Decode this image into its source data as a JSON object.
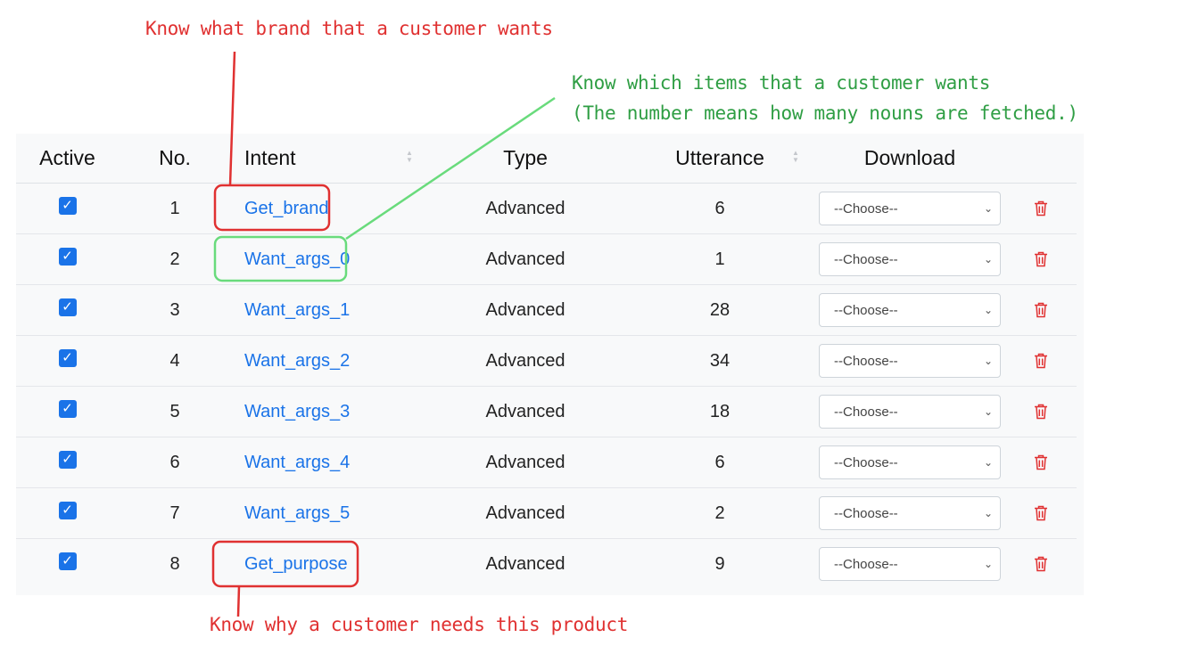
{
  "annotations": {
    "top": "Know what brand that a customer wants",
    "right_line1": "Know which items that a customer wants",
    "right_line2": "(The number means how many nouns are fetched.)",
    "bottom": "Know why a customer needs this product"
  },
  "colors": {
    "red": "#e03131",
    "green": "#2f9e44",
    "link": "#1a73e8",
    "checkbox": "#1a73e8"
  },
  "table": {
    "headers": {
      "active": "Active",
      "no": "No.",
      "intent": "Intent",
      "type": "Type",
      "utterance": "Utterance",
      "download": "Download"
    },
    "rows": [
      {
        "no": "1",
        "intent": "Get_brand",
        "type": "Advanced",
        "utterance": "6",
        "download": "--Choose--",
        "active": true
      },
      {
        "no": "2",
        "intent": "Want_args_0",
        "type": "Advanced",
        "utterance": "1",
        "download": "--Choose--",
        "active": true
      },
      {
        "no": "3",
        "intent": "Want_args_1",
        "type": "Advanced",
        "utterance": "28",
        "download": "--Choose--",
        "active": true
      },
      {
        "no": "4",
        "intent": "Want_args_2",
        "type": "Advanced",
        "utterance": "34",
        "download": "--Choose--",
        "active": true
      },
      {
        "no": "5",
        "intent": "Want_args_3",
        "type": "Advanced",
        "utterance": "18",
        "download": "--Choose--",
        "active": true
      },
      {
        "no": "6",
        "intent": "Want_args_4",
        "type": "Advanced",
        "utterance": "6",
        "download": "--Choose--",
        "active": true
      },
      {
        "no": "7",
        "intent": "Want_args_5",
        "type": "Advanced",
        "utterance": "2",
        "download": "--Choose--",
        "active": true
      },
      {
        "no": "8",
        "intent": "Get_purpose",
        "type": "Advanced",
        "utterance": "9",
        "download": "--Choose--",
        "active": true
      }
    ]
  },
  "icons": {
    "checkbox": "check-icon",
    "sort": "sort-icon",
    "select": "chevron-down-icon",
    "delete": "trash-icon"
  }
}
